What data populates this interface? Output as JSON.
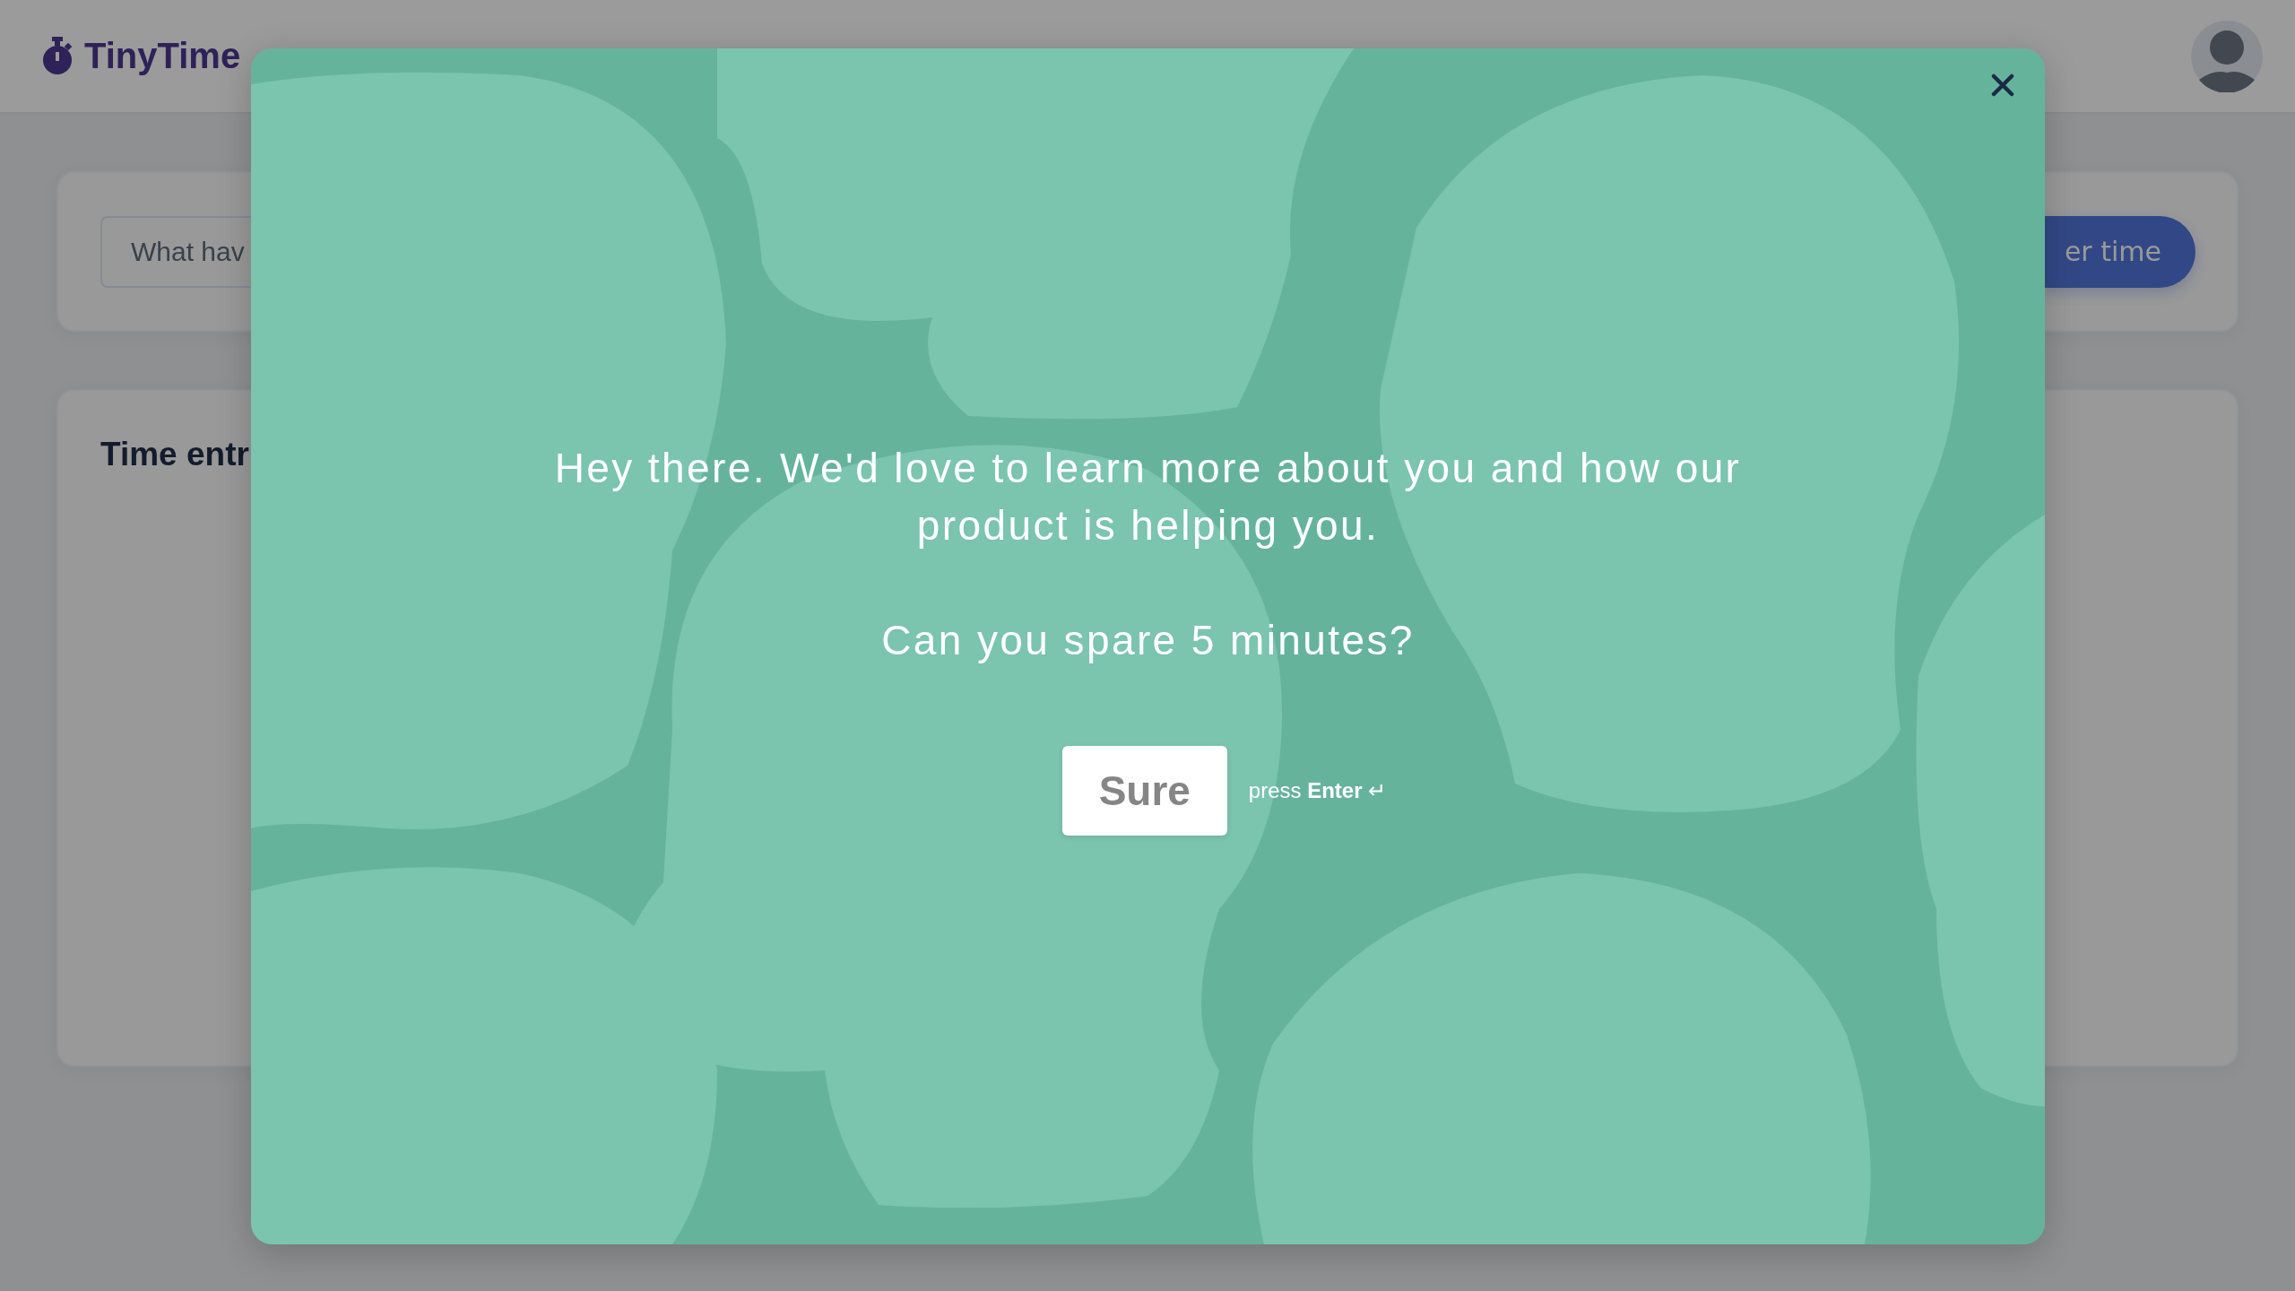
{
  "header": {
    "logo": "TinyTime"
  },
  "entry_card": {
    "description_field": {
      "placeholder": "What hav"
    },
    "submit_button": "er time"
  },
  "entries_card": {
    "title": "Time entr"
  },
  "survey_modal": {
    "message": "Hey there. We'd love to learn more about you and how our product is helping you.",
    "question": "Can you spare 5 minutes?",
    "button": "Sure",
    "hint": "press **Enter** ↵"
  }
}
